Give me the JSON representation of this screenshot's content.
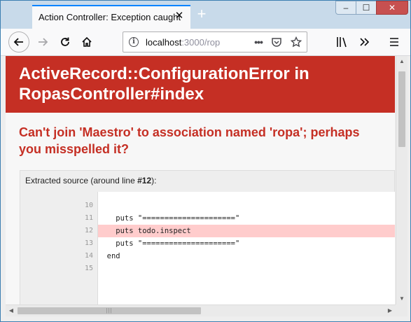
{
  "window": {
    "tab_title": "Action Controller: Exception caught",
    "close_tab_glyph": "✕",
    "new_tab_glyph": "+",
    "minimize_glyph": "‒",
    "maximize_glyph": "☐",
    "close_glyph": "✕"
  },
  "toolbar": {
    "url_host": "localhost",
    "url_path": ":3000/rop",
    "icons": [
      "back-icon",
      "forward-icon",
      "reload-icon",
      "home-icon",
      "site-info-icon",
      "page-actions-icon",
      "pocket-icon",
      "bookmark-star-icon",
      "library-icon",
      "overflow-icon",
      "menu-icon"
    ]
  },
  "page": {
    "error_title": "ActiveRecord::ConfigurationError in RopasController#index",
    "error_message": "Can't join 'Maestro' to association named 'ropa'; perhaps you misspelled it?",
    "source_caption_prefix": "Extracted source (around line ",
    "source_caption_line": "#12",
    "source_caption_suffix": "):",
    "lines": [
      {
        "no": "10",
        "code": ""
      },
      {
        "no": "11",
        "code": "    puts \"=====================\""
      },
      {
        "no": "12",
        "code": "    puts todo.inspect",
        "highlight": true
      },
      {
        "no": "13",
        "code": "    puts \"=====================\""
      },
      {
        "no": "14",
        "code": "  end"
      },
      {
        "no": "15",
        "code": ""
      }
    ]
  },
  "colors": {
    "error_red": "#c52f24",
    "highlight_line": "#ffcccc",
    "tab_accent": "#0a84ff"
  }
}
